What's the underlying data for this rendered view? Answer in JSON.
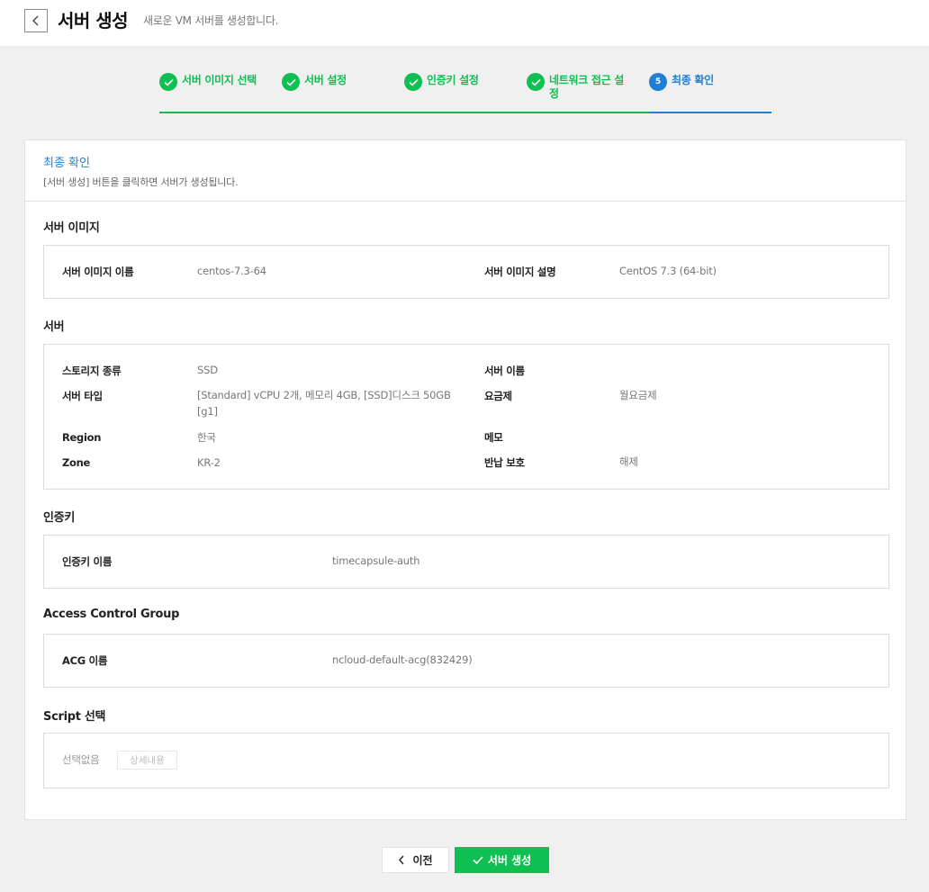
{
  "header": {
    "title": "서버 생성",
    "subtitle": "새로운 VM 서버를 생성합니다."
  },
  "steps": [
    {
      "label": "서버 이미지 선택",
      "status": "done"
    },
    {
      "label": "서버 설정",
      "status": "done"
    },
    {
      "label": "인증키 설정",
      "status": "done"
    },
    {
      "label": "네트워크 접근 설정",
      "status": "done"
    },
    {
      "label": "최종 확인",
      "status": "active",
      "number": "5"
    }
  ],
  "panel": {
    "title": "최종 확인",
    "description": "[서버 생성] 버튼을 클릭하면 서버가 생성됩니다."
  },
  "sections": {
    "image": {
      "title": "서버 이미지",
      "name_label": "서버 이미지 이름",
      "name_value": "centos-7.3-64",
      "desc_label": "서버 이미지 설명",
      "desc_value": "CentOS 7.3 (64-bit)"
    },
    "server": {
      "title": "서버",
      "storage_label": "스토리지 종류",
      "storage_value": "SSD",
      "type_label": "서버 타입",
      "type_value": "[Standard] vCPU 2개, 메모리 4GB, [SSD]디스크 50GB [g1]",
      "region_label": "Region",
      "region_value": "한국",
      "zone_label": "Zone",
      "zone_value": "KR-2",
      "name_label": "서버 이름",
      "name_value": "",
      "plan_label": "요금제",
      "plan_value": "월요금제",
      "memo_label": "메모",
      "memo_value": "",
      "protect_label": "반납 보호",
      "protect_value": "해제"
    },
    "auth": {
      "title": "인증키",
      "key_label": "인증키 이름",
      "key_value": "timecapsule-auth"
    },
    "acg": {
      "title": "Access Control Group",
      "name_label": "ACG 이름",
      "name_value": "ncloud-default-acg(832429)"
    },
    "script": {
      "title": "Script 선택",
      "value": "선택없음",
      "detail_label": "상세내용"
    }
  },
  "footer": {
    "prev_label": "이전",
    "create_label": "서버 생성"
  },
  "colors": {
    "success": "#0ebf51",
    "active": "#1e7fd8"
  }
}
